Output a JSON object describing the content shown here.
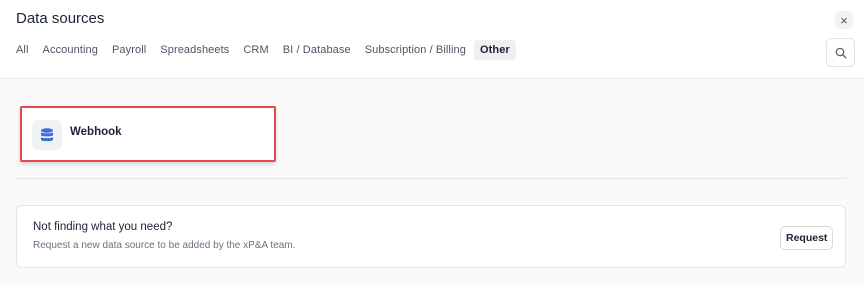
{
  "header": {
    "title": "Data sources",
    "close_glyph": "×",
    "search_icon": "search-icon"
  },
  "tabs": [
    {
      "label": "All",
      "active": false
    },
    {
      "label": "Accounting",
      "active": false
    },
    {
      "label": "Payroll",
      "active": false
    },
    {
      "label": "Spreadsheets",
      "active": false
    },
    {
      "label": "CRM",
      "active": false
    },
    {
      "label": "BI / Database",
      "active": false
    },
    {
      "label": "Subscription / Billing",
      "active": false
    },
    {
      "label": "Other",
      "active": true
    }
  ],
  "sources": [
    {
      "label": "Webhook",
      "icon": "database-icon",
      "icon_color": "#3b6fd8"
    }
  ],
  "request": {
    "title": "Not finding what you need?",
    "description": "Request a new data source to be added by the xP&A team.",
    "button_label": "Request"
  },
  "colors": {
    "highlight_border": "#e5484d",
    "active_tab_bg": "#efefef"
  }
}
